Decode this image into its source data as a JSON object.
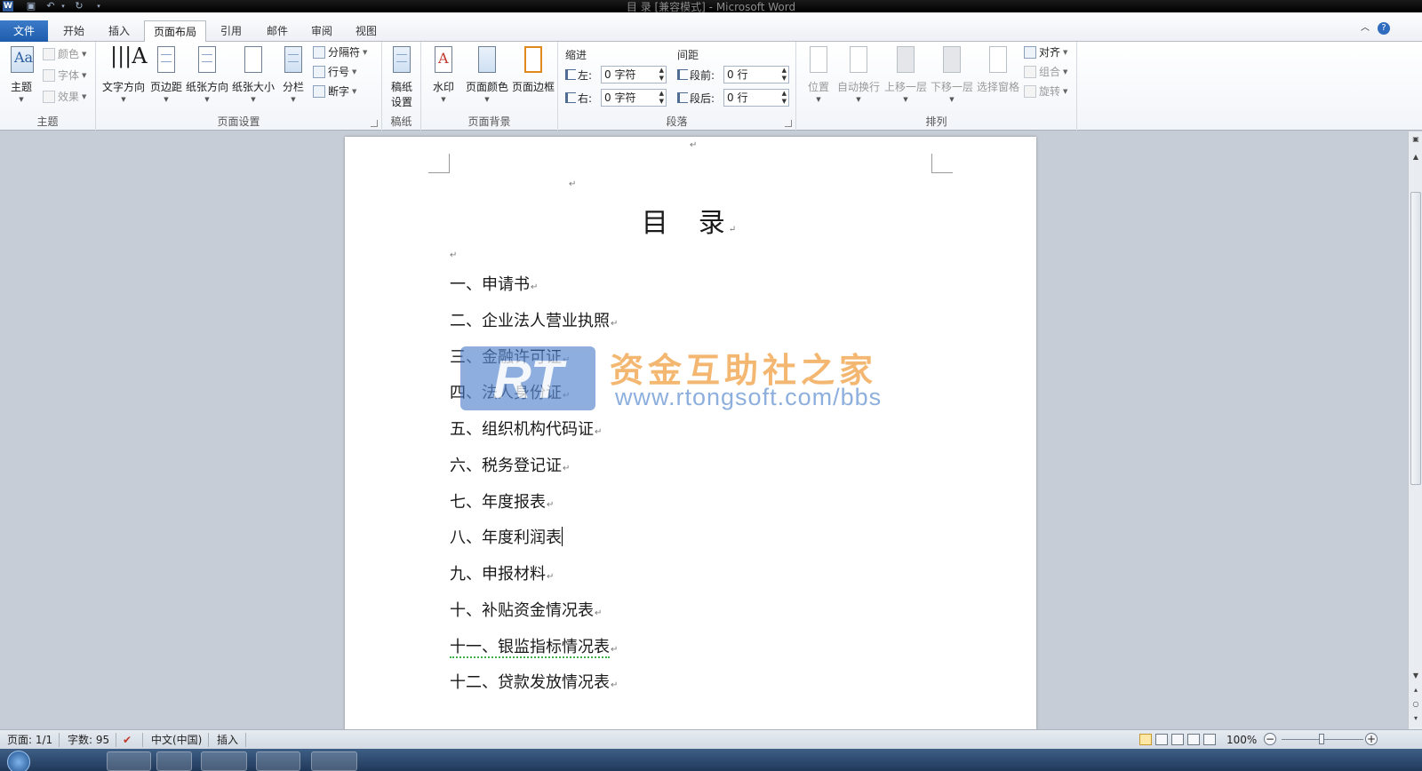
{
  "window": {
    "title": "目 录 [兼容模式] - Microsoft Word",
    "app_icon": "W"
  },
  "quick_access": {
    "icons": [
      "save-icon",
      "undo-icon",
      "redo-icon",
      "customize-icon"
    ]
  },
  "tabs": {
    "file": "文件",
    "items": [
      "开始",
      "插入",
      "页面布局",
      "引用",
      "邮件",
      "审阅",
      "视图"
    ],
    "active": "页面布局"
  },
  "ribbon": {
    "theme": {
      "label": "主题",
      "theme_btn": "主题",
      "colors": "颜色",
      "fonts": "字体",
      "effects": "效果"
    },
    "page_setup": {
      "label": "页面设置",
      "text_direction": "文字方向",
      "margins": "页边距",
      "orientation": "纸张方向",
      "size": "纸张大小",
      "columns": "分栏",
      "breaks": "分隔符",
      "line_numbers": "行号",
      "hyphenation": "断字"
    },
    "manuscript": {
      "label": "稿纸",
      "settings_line1": "稿纸",
      "settings_line2": "设置"
    },
    "page_background": {
      "label": "页面背景",
      "watermark": "水印",
      "page_color": "页面颜色",
      "page_borders": "页面边框"
    },
    "paragraph": {
      "label": "段落",
      "indent_title": "缩进",
      "spacing_title": "间距",
      "left_label": "左:",
      "left_value": "0 字符",
      "right_label": "右:",
      "right_value": "0 字符",
      "before_label": "段前:",
      "before_value": "0 行",
      "after_label": "段后:",
      "after_value": "0 行"
    },
    "arrange": {
      "label": "排列",
      "position": "位置",
      "wrap_text": "自动换行",
      "bring_forward": "上移一层",
      "send_backward": "下移一层",
      "selection_pane": "选择窗格",
      "align": "对齐",
      "group": "组合",
      "rotate": "旋转"
    }
  },
  "document": {
    "title_part1": "目",
    "title_part2": "录",
    "paragraph_mark": "↵",
    "toc": [
      "一、申请书",
      "二、企业法人营业执照",
      "三、金融许可证",
      "四、法人身份证",
      "五、组织机构代码证",
      "六、税务登记证",
      "七、年度报表",
      "八、年度利润表",
      "九、申报材料",
      "十、补贴资金情况表",
      "十一、银监指标情况表",
      "十二、贷款发放情况表"
    ]
  },
  "watermark": {
    "logo": "RT",
    "text_cn": "资金互助社之家",
    "url": "www.rtongsoft.com/bbs"
  },
  "statusbar": {
    "page": "页面: 1/1",
    "words": "字数: 95",
    "language": "中文(中国)",
    "mode": "插入",
    "zoom": "100%",
    "zoom_level_percent": 100
  },
  "colors": {
    "file_tab": "#1e5bac",
    "watermark_cn": "#f1a44a",
    "watermark_url": "#6e99d4",
    "workspace": "#c7cdd6"
  }
}
